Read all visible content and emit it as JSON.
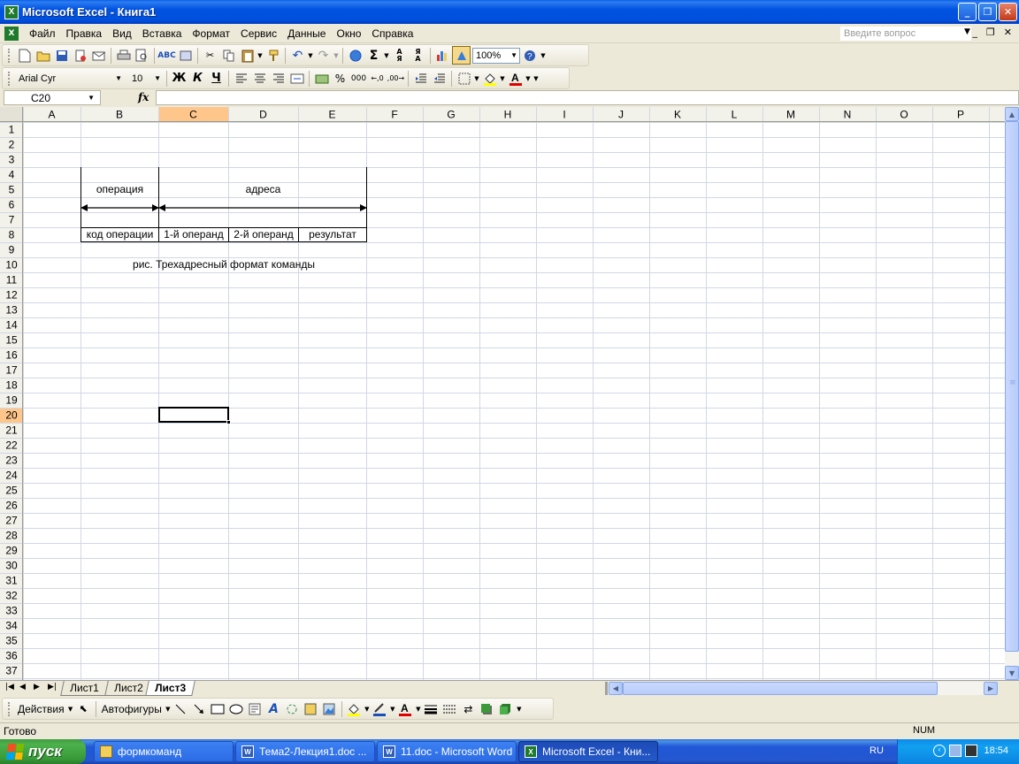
{
  "window": {
    "title": "Microsoft Excel - Книга1"
  },
  "menu": {
    "items": [
      "Файл",
      "Правка",
      "Вид",
      "Вставка",
      "Формат",
      "Сервис",
      "Данные",
      "Окно",
      "Справка"
    ],
    "help_placeholder": "Введите вопрос"
  },
  "toolbar": {
    "zoom": "100%"
  },
  "format_toolbar": {
    "font": "Arial Cyr",
    "size": "10",
    "bold": "Ж",
    "italic": "К",
    "underline": "Ч",
    "percent": "%",
    "thousands": "000"
  },
  "formula_bar": {
    "name_box": "C20",
    "fx": "fx",
    "value": ""
  },
  "columns": [
    "A",
    "B",
    "C",
    "D",
    "E",
    "F",
    "G",
    "H",
    "I",
    "J",
    "K",
    "L",
    "M",
    "N",
    "O",
    "P"
  ],
  "rows": [
    "1",
    "2",
    "3",
    "4",
    "5",
    "6",
    "7",
    "8",
    "9",
    "10",
    "11",
    "12",
    "13",
    "14",
    "15",
    "16",
    "17",
    "18",
    "19",
    "20",
    "21",
    "22",
    "23",
    "24",
    "25",
    "26",
    "27",
    "28",
    "29",
    "30",
    "31",
    "32",
    "33",
    "34",
    "35",
    "36",
    "37"
  ],
  "active_cell": {
    "column": "C",
    "row": 20
  },
  "sheet_content": {
    "operation": "операция",
    "addresses": "адреса",
    "opcode": "код операции",
    "operand1": "1-й операнд",
    "operand2": "2-й операнд",
    "result": "результат",
    "caption": "рис. Трехадресный формат команды"
  },
  "sheet_tabs": [
    {
      "label": "Лист1",
      "active": false
    },
    {
      "label": "Лист2",
      "active": false
    },
    {
      "label": "Лист3",
      "active": true
    }
  ],
  "drawing_toolbar": {
    "actions": "Действия",
    "autoshapes": "Автофигуры"
  },
  "status": {
    "text": "Готово",
    "num": "NUM"
  },
  "taskbar": {
    "start": "пуск",
    "tasks": [
      {
        "label": "формкоманд",
        "icon": "folder-icon",
        "active": false
      },
      {
        "label": "Тема2-Лекция1.doc ...",
        "icon": "word-icon",
        "active": false
      },
      {
        "label": "11.doc - Microsoft Word",
        "icon": "word-icon",
        "active": false
      },
      {
        "label": "Microsoft Excel - Кни...",
        "icon": "excel-icon",
        "active": true
      }
    ],
    "language": "RU",
    "clock": "18:54"
  },
  "colors": {
    "title_blue": "#0050DC",
    "excel_green": "#1F7A2C",
    "start_green": "#3E9B3E",
    "active_header": "#FFC68C"
  }
}
